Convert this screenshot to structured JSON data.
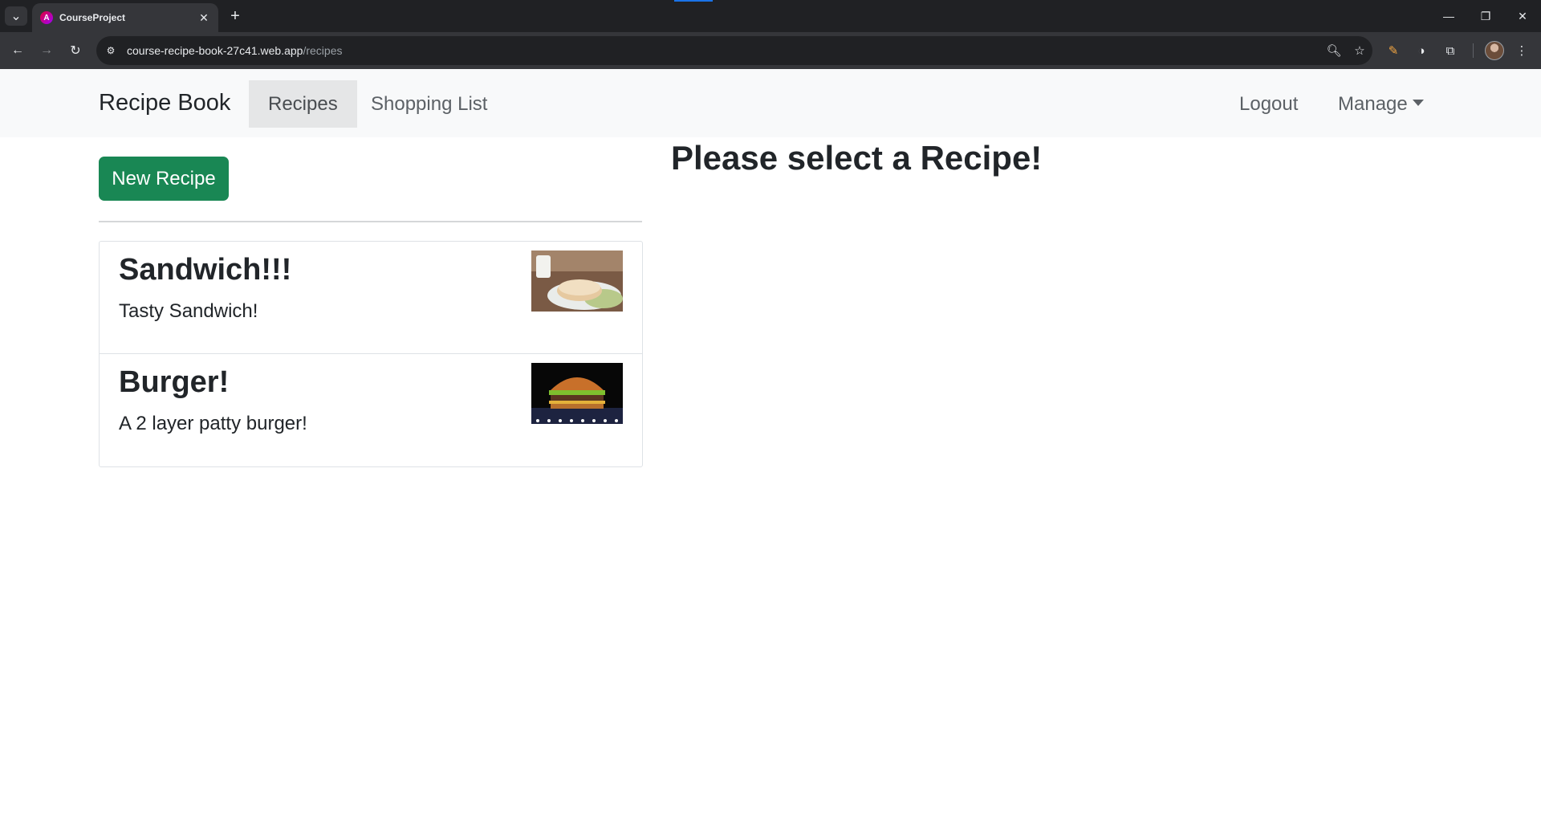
{
  "browser": {
    "tab_title": "CourseProject",
    "url_host": "course-recipe-book-27c41.web.app",
    "url_path": "/recipes"
  },
  "navbar": {
    "brand": "Recipe Book",
    "links": [
      {
        "label": "Recipes",
        "active": true
      },
      {
        "label": "Shopping List",
        "active": false
      }
    ],
    "logout": "Logout",
    "manage": "Manage"
  },
  "actions": {
    "new_recipe": "New Recipe"
  },
  "recipes": [
    {
      "name": "Sandwich!!!",
      "description": "Tasty Sandwich!",
      "image": "sandwich-photo"
    },
    {
      "name": "Burger!",
      "description": "A 2 layer patty burger!",
      "image": "burger-photo"
    }
  ],
  "detail": {
    "placeholder": "Please select a Recipe!"
  },
  "colors": {
    "success": "#198754",
    "navbar_bg": "#f8f9fa",
    "chrome_dark": "#202124",
    "chrome_toolbar": "#35363a"
  }
}
